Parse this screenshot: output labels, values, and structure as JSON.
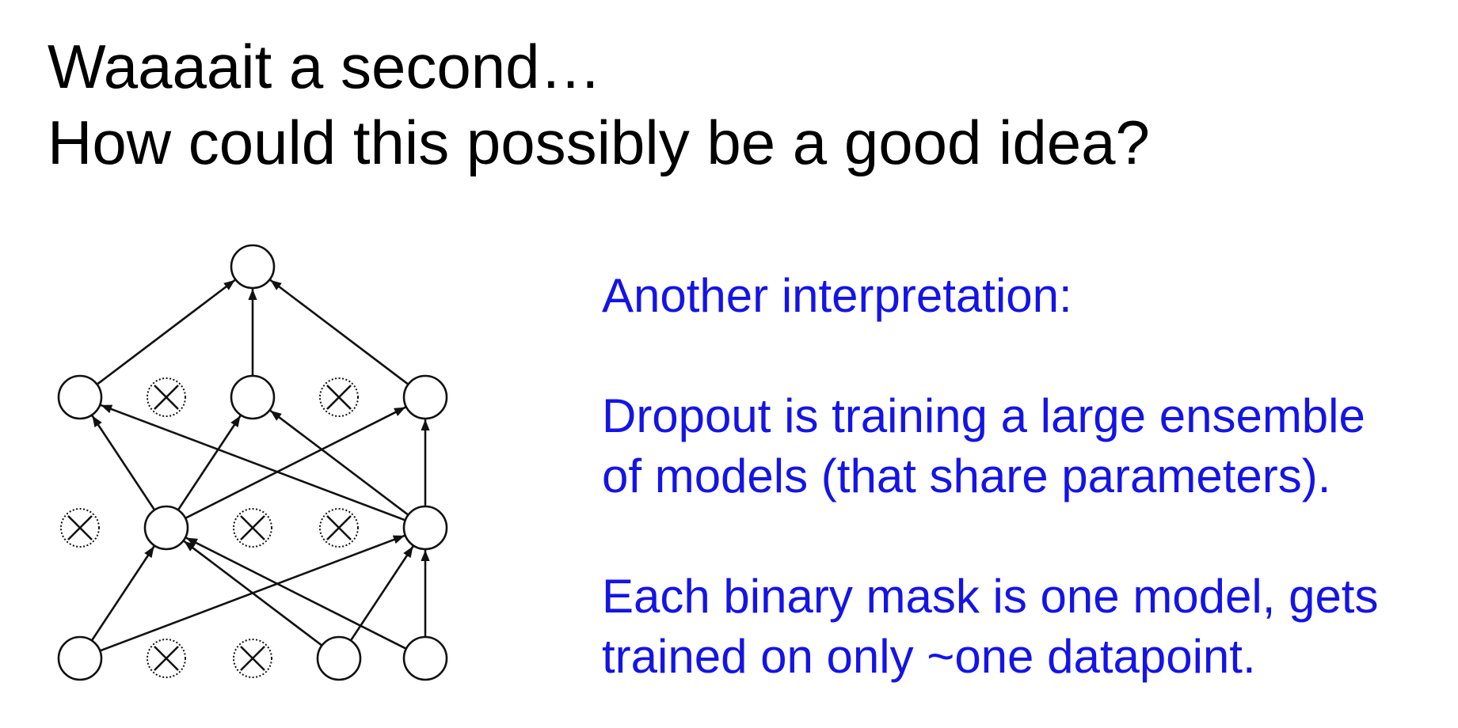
{
  "slide": {
    "title_line1": "Waaaait a second…",
    "title_line2": "How could this possibly be a good idea?",
    "interpretation_heading": "Another interpretation:",
    "point1_line1": "Dropout is training a large ensemble",
    "point1_line2": "of models (that share parameters).",
    "point2_line1": "Each binary mask is one model, gets",
    "point2_line2": "trained on only ~one datapoint."
  },
  "colors": {
    "title": "#000000",
    "body_text": "#1414e6",
    "diagram_stroke": "#111111"
  },
  "diagram": {
    "layers": [
      {
        "name": "input",
        "units": [
          "active",
          "dropped",
          "dropped",
          "active",
          "active"
        ]
      },
      {
        "name": "hidden-1",
        "units": [
          "dropped",
          "active",
          "dropped",
          "dropped",
          "active"
        ]
      },
      {
        "name": "hidden-2",
        "units": [
          "active",
          "dropped",
          "active",
          "dropped",
          "active"
        ]
      },
      {
        "name": "output",
        "units": [
          "active"
        ]
      }
    ],
    "connections": [
      {
        "from": [
          "input",
          0
        ],
        "to": [
          "hidden-1",
          1
        ]
      },
      {
        "from": [
          "input",
          0
        ],
        "to": [
          "hidden-1",
          4
        ]
      },
      {
        "from": [
          "input",
          3
        ],
        "to": [
          "hidden-1",
          1
        ]
      },
      {
        "from": [
          "input",
          3
        ],
        "to": [
          "hidden-1",
          4
        ]
      },
      {
        "from": [
          "input",
          4
        ],
        "to": [
          "hidden-1",
          1
        ]
      },
      {
        "from": [
          "input",
          4
        ],
        "to": [
          "hidden-1",
          4
        ]
      },
      {
        "from": [
          "hidden-1",
          1
        ],
        "to": [
          "hidden-2",
          0
        ]
      },
      {
        "from": [
          "hidden-1",
          1
        ],
        "to": [
          "hidden-2",
          2
        ]
      },
      {
        "from": [
          "hidden-1",
          1
        ],
        "to": [
          "hidden-2",
          4
        ]
      },
      {
        "from": [
          "hidden-1",
          4
        ],
        "to": [
          "hidden-2",
          0
        ]
      },
      {
        "from": [
          "hidden-1",
          4
        ],
        "to": [
          "hidden-2",
          2
        ]
      },
      {
        "from": [
          "hidden-1",
          4
        ],
        "to": [
          "hidden-2",
          4
        ]
      },
      {
        "from": [
          "hidden-2",
          0
        ],
        "to": [
          "output",
          0
        ]
      },
      {
        "from": [
          "hidden-2",
          2
        ],
        "to": [
          "output",
          0
        ]
      },
      {
        "from": [
          "hidden-2",
          4
        ],
        "to": [
          "output",
          0
        ]
      }
    ]
  }
}
